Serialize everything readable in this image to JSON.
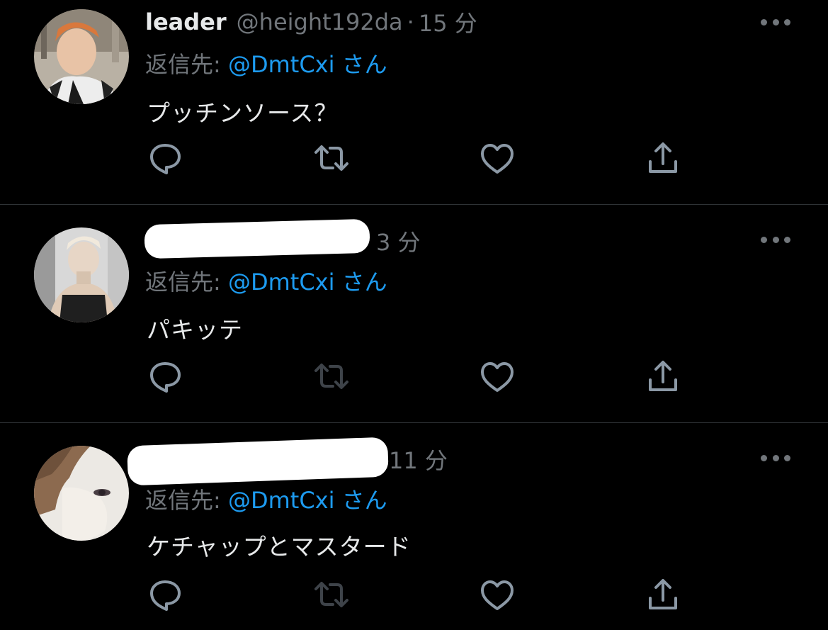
{
  "colors": {
    "background": "#000000",
    "primary_text": "#e7e9ea",
    "secondary_text": "#71767b",
    "mention": "#1d9bf0",
    "divider": "#2f3336"
  },
  "tweets": [
    {
      "name": "leader",
      "handle": "@height192da",
      "separator": "·",
      "time": "15 分",
      "reply_prefix": "返信先:",
      "reply_mention": "@DmtCxi",
      "reply_suffix": "さん",
      "text": "プッチンソース？",
      "actions": [
        "reply-icon",
        "retweet-icon",
        "like-icon",
        "share-icon"
      ]
    },
    {
      "name": "",
      "handle": "",
      "time": "3 分",
      "name_redacted": true,
      "reply_prefix": "返信先:",
      "reply_mention": "@DmtCxi",
      "reply_suffix": "さん",
      "text": "パキッテ",
      "actions": [
        "reply-icon",
        "retweet-icon",
        "like-icon",
        "share-icon"
      ]
    },
    {
      "name": "",
      "handle": "",
      "time": "11 分",
      "name_redacted": true,
      "reply_prefix": "返信先:",
      "reply_mention": "@DmtCxi",
      "reply_suffix": "さん",
      "text": "ケチャップとマスタード",
      "actions": [
        "reply-icon",
        "retweet-icon",
        "like-icon",
        "share-icon"
      ]
    }
  ]
}
